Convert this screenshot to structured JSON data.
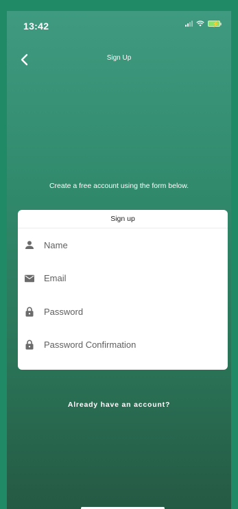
{
  "status_bar": {
    "time": "13:42"
  },
  "nav": {
    "title": "Sign Up",
    "back_icon": "chevron-left-icon"
  },
  "intro": {
    "text": "Create a free account using the form below."
  },
  "form": {
    "header": "Sign up",
    "fields": [
      {
        "icon": "person-icon",
        "placeholder": "Name",
        "value": ""
      },
      {
        "icon": "envelope-icon",
        "placeholder": "Email",
        "value": ""
      },
      {
        "icon": "lock-icon",
        "placeholder": "Password",
        "value": ""
      },
      {
        "icon": "lock-icon",
        "placeholder": "Password Confirmation",
        "value": ""
      }
    ]
  },
  "footer": {
    "signin_link": "Already have an account?"
  },
  "colors": {
    "background_top": "#3f9a80",
    "background_bottom": "#255944",
    "frame": "#1f8a65",
    "card": "#ffffff",
    "icon_gray": "#6b6b6b",
    "battery_green": "#8be36c"
  }
}
